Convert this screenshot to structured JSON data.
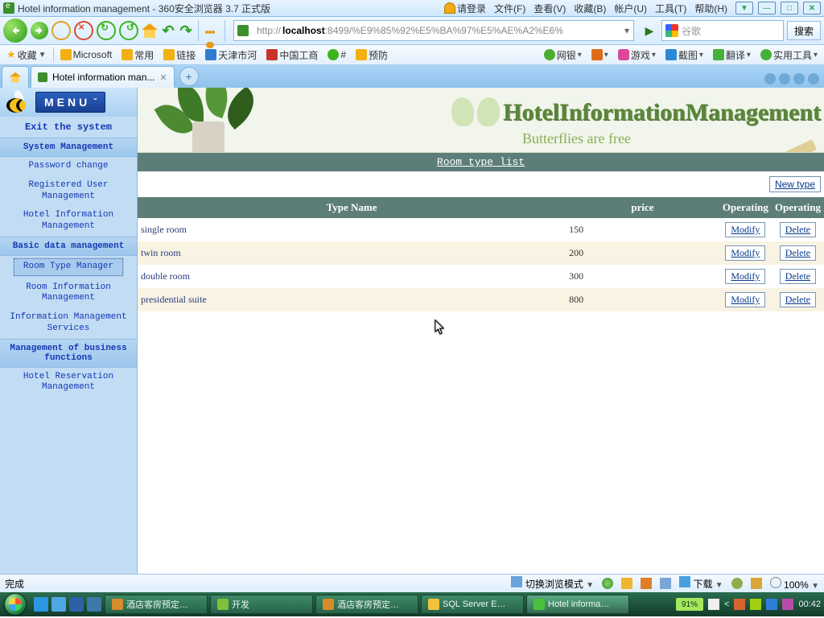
{
  "window_title": "Hotel information management - 360安全浏览器 3.7 正式版",
  "browser_menu": {
    "login": "请登录",
    "file": "文件(F)",
    "view": "查看(V)",
    "fav": "收藏(B)",
    "account": "帐户(U)",
    "tools": "工具(T)",
    "help": "帮助(H)"
  },
  "url": {
    "scheme": "http://",
    "host": "localhost",
    "rest": ":8499/%E9%85%92%E5%BA%97%E5%AE%A2%E6%"
  },
  "search": {
    "placeholder": "谷歌",
    "button": "搜索"
  },
  "bookmarks_left": [
    "收藏",
    "Microsoft",
    "常用",
    "链接",
    "天津市河",
    "中国工商",
    "#",
    "预防"
  ],
  "bookmarks_right": [
    "网银",
    "",
    "游戏",
    "截图",
    "翻译",
    "实用工具"
  ],
  "tab_title": "Hotel information man...",
  "sidebar": {
    "menu_label": "MENU",
    "exit": "Exit the system",
    "sect1": "System Management",
    "items1": [
      "Password change",
      "Registered User\nManagement",
      "Hotel Information\nManagement"
    ],
    "sect2": "Basic data management",
    "items2": [
      "Room Type Manager",
      "Room Information\nManagement",
      "Information Management\nServices"
    ],
    "sect3": "Management of business\nfunctions",
    "items3": [
      "Hotel Reservation\nManagement"
    ]
  },
  "banner_tag": "Butterflies are free",
  "banner_logo": "HotelInformationManagement",
  "list_title": "Room type list",
  "new_type": "New type",
  "columns": {
    "name": "Type Name",
    "price": "price",
    "op1": "Operating",
    "op2": "Operating"
  },
  "rows": [
    {
      "name": "single room",
      "price": "150"
    },
    {
      "name": "twin room",
      "price": "200"
    },
    {
      "name": "double room",
      "price": "300"
    },
    {
      "name": "presidential suite",
      "price": "800"
    }
  ],
  "row_buttons": {
    "modify": "Modify",
    "delete": "Delete"
  },
  "status": {
    "left": "完成",
    "switch_mode": "切换浏览模式",
    "download": "下载",
    "zoom": "100%"
  },
  "taskbar": {
    "tasks": [
      {
        "label": "酒店客房预定…",
        "color": "#d78c2a"
      },
      {
        "label": "开发",
        "color": "#7fbf3a"
      },
      {
        "label": "酒店客房预定…",
        "color": "#d78c2a"
      },
      {
        "label": "SQL Server E…",
        "color": "#f2c23c"
      },
      {
        "label": "Hotel informa…",
        "color": "#49c13c",
        "active": true
      }
    ],
    "battery": "91%",
    "time": "00:42"
  }
}
